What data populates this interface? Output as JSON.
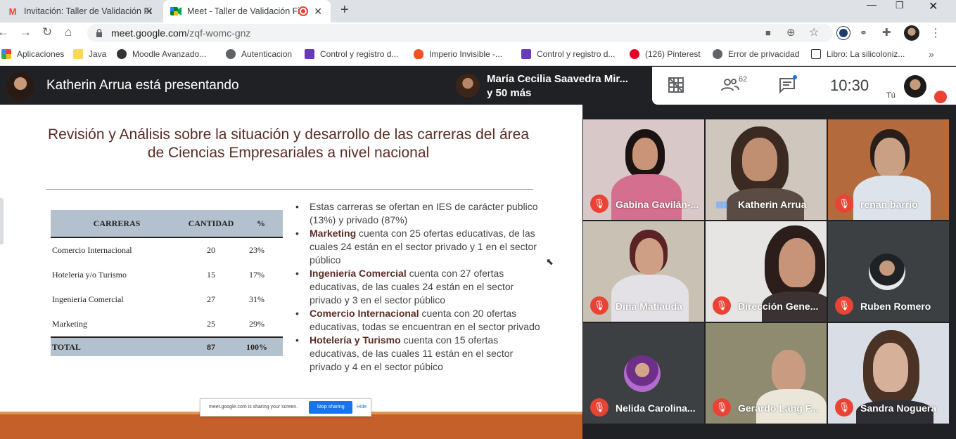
{
  "browser": {
    "tabs": [
      {
        "title": "Invitación: Taller de Validación Fi",
        "icon": "gmail-icon"
      },
      {
        "title": "Meet - Taller de Validación Fi",
        "icon": "meet-icon",
        "recording": true
      }
    ],
    "url_host": "meet.google.com",
    "url_path": "/zqf-womc-gnz",
    "bookmarks": [
      {
        "label": "Aplicaciones",
        "icon": "apps-grid-icon"
      },
      {
        "label": "Java",
        "icon": "folder-icon"
      },
      {
        "label": "Moodle Avanzado...",
        "icon": "moodle-icon"
      },
      {
        "label": "Autenticacion",
        "icon": "globe-icon"
      },
      {
        "label": "Control y registro d...",
        "icon": "forms-icon"
      },
      {
        "label": "Imperio Invisible -...",
        "icon": "flame-icon"
      },
      {
        "label": "Control y registro d...",
        "icon": "forms-icon"
      },
      {
        "label": "(126) Pinterest",
        "icon": "pinterest-icon"
      },
      {
        "label": "Error de privacidad",
        "icon": "globe-icon"
      },
      {
        "label": "Libro: La silicoloniz...",
        "icon": "jmb-icon"
      }
    ]
  },
  "meet": {
    "presenter_text": "Katherin Arrua está presentando",
    "pinned_name": "María Cecilia Saavedra Mir...",
    "pinned_more": "y 50 más",
    "participant_count": "62",
    "time": "10:30",
    "self_label": "Tú",
    "tiles": [
      {
        "name": "Gabina Gavilán-...",
        "muted": true
      },
      {
        "name": "Katherin Arrua",
        "muted": false,
        "speaking": true
      },
      {
        "name": "renan barrio",
        "muted": true
      },
      {
        "name": "Dina Matiauda",
        "muted": true
      },
      {
        "name": "Dirección Gene...",
        "muted": true
      },
      {
        "name": "Ruben Romero",
        "muted": true
      },
      {
        "name": "Nelida Carolina...",
        "muted": true
      },
      {
        "name": "Gerardo Lang F...",
        "muted": true
      },
      {
        "name": "Sandra Noguera",
        "muted": true
      }
    ]
  },
  "slide": {
    "title_line1": "Revisión y Análisis sobre la situación y desarrollo de las carreras del área",
    "title_line2": "de Ciencias Empresariales a nivel nacional",
    "table": {
      "headers": [
        "CARRERAS",
        "CANTIDAD",
        "%"
      ],
      "rows": [
        [
          "Comercio Internacional",
          "20",
          "23%"
        ],
        [
          "Hoteleria y/o Turismo",
          "15",
          "17%"
        ],
        [
          "Ingenieria Comercial",
          "27",
          "31%"
        ],
        [
          "Marketing",
          "25",
          "29%"
        ]
      ],
      "total": [
        "TOTAL",
        "87",
        "100%"
      ]
    },
    "bullets": [
      {
        "bold": "",
        "text": "Estas carreras se ofertan en IES de carácter publico (13%) y privado (87%)"
      },
      {
        "bold": "Marketing",
        "text": " cuenta con 25 ofertas educativas, de las cuales 24 están en el sector privado y 1 en el sector público"
      },
      {
        "bold": "Ingeniería Comercial",
        "text": " cuenta con 27 ofertas educativas, de las cuales 24 están en el sector privado y 3 en el sector público"
      },
      {
        "bold": "Comercio Internacional",
        "text": " cuenta con 20 ofertas educativas, todas se encuentran en el sector privado"
      },
      {
        "bold": "Hotelería y Turismo",
        "text": " cuenta con 15 ofertas educativas, de las cuales 11 están en el sector privado y 4 en el sector púbico"
      }
    ],
    "share_notice": "meet.google.com is sharing your screen.",
    "stop_sharing_label": "Stop sharing",
    "hide_label": "Hide"
  },
  "colors": {
    "meet_bg": "#202124",
    "mic_off": "#ea4335",
    "slide_title": "#5a2c25",
    "table_header": "#b3c1cf",
    "slide_band": "#c5602b"
  }
}
